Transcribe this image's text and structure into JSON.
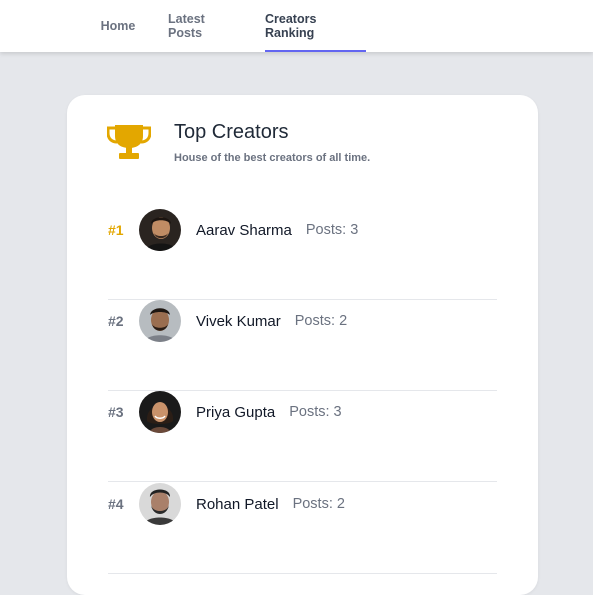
{
  "nav": {
    "tabs": [
      {
        "label": "Home"
      },
      {
        "label": "Latest Posts"
      },
      {
        "label": "Creators Ranking"
      }
    ],
    "active_tab": "Creators Ranking"
  },
  "card": {
    "icon": "trophy-icon",
    "title": "Top Creators",
    "subtitle": "House of the best creators of all time."
  },
  "creators": [
    {
      "rank": "#1",
      "name": "Aarav Sharma",
      "posts": "Posts: 3"
    },
    {
      "rank": "#2",
      "name": "Vivek Kumar",
      "posts": "Posts: 2"
    },
    {
      "rank": "#3",
      "name": "Priya Gupta",
      "posts": "Posts: 3"
    },
    {
      "rank": "#4",
      "name": "Rohan Patel",
      "posts": "Posts: 2"
    }
  ],
  "colors": {
    "accent": "#6366f1",
    "gold": "#e3a700",
    "background": "#e5e7eb"
  }
}
